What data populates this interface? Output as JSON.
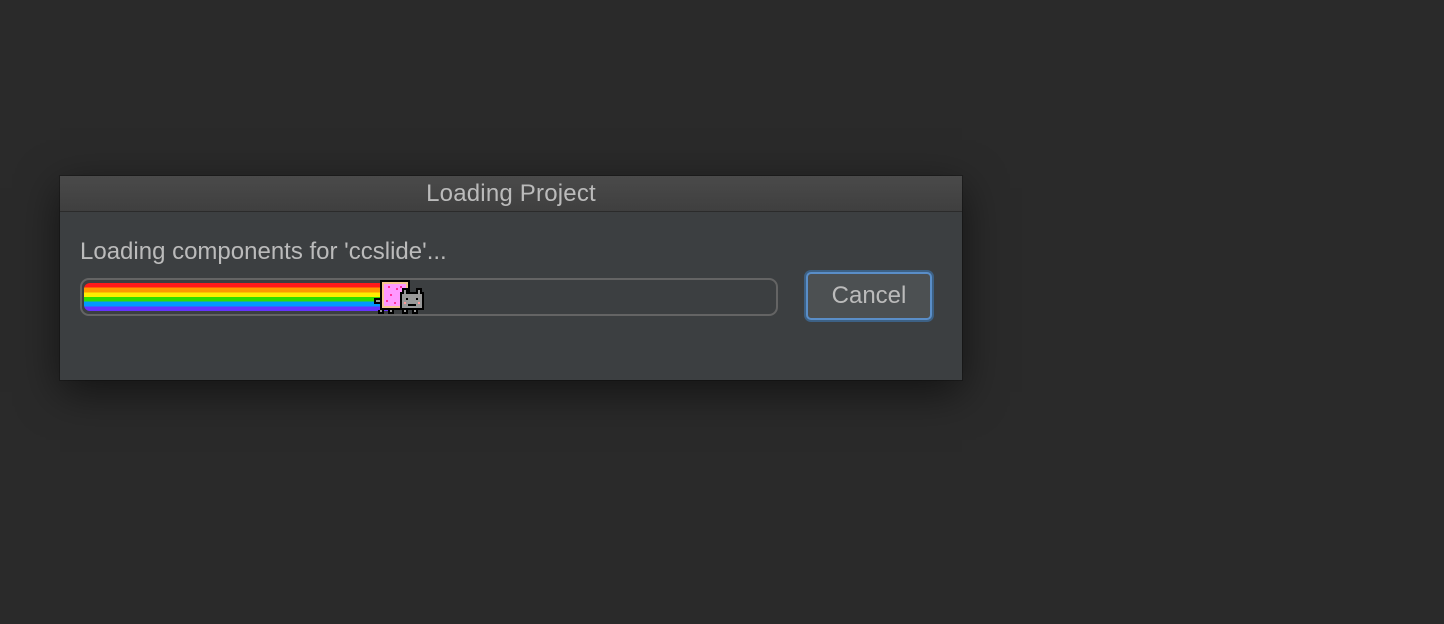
{
  "dialog": {
    "title": "Loading Project",
    "message": "Loading components for 'ccslide'...",
    "progress": {
      "fraction": 0.44,
      "icon": "nyan-cat-icon"
    },
    "cancel_label": "Cancel"
  },
  "colors": {
    "background": "#2a2a2a",
    "dialog_bg": "#3c3f41",
    "text": "#bbbbbb",
    "focus_ring": "#5a8ec8"
  }
}
